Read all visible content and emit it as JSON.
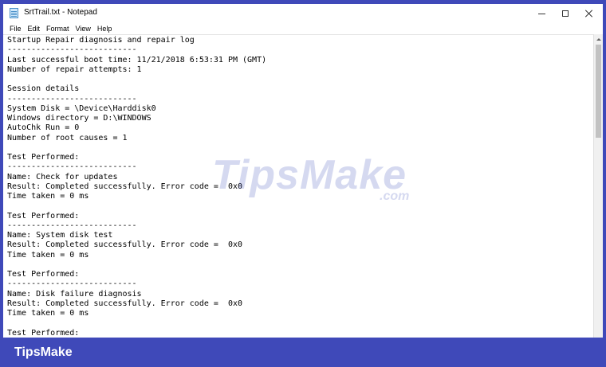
{
  "window": {
    "title": "SrtTrail.txt - Notepad"
  },
  "menu": {
    "items": [
      "File",
      "Edit",
      "Format",
      "View",
      "Help"
    ]
  },
  "document": {
    "lines": [
      "Startup Repair diagnosis and repair log",
      "---------------------------",
      "Last successful boot time: 11/21/2018 6:53:31 PM (GMT)",
      "Number of repair attempts: 1",
      "",
      "Session details",
      "---------------------------",
      "System Disk = \\Device\\Harddisk0",
      "Windows directory = D:\\WINDOWS",
      "AutoChk Run = 0",
      "Number of root causes = 1",
      "",
      "Test Performed:",
      "---------------------------",
      "Name: Check for updates",
      "Result: Completed successfully. Error code =  0x0",
      "Time taken = 0 ms",
      "",
      "Test Performed:",
      "---------------------------",
      "Name: System disk test",
      "Result: Completed successfully. Error code =  0x0",
      "Time taken = 0 ms",
      "",
      "Test Performed:",
      "---------------------------",
      "Name: Disk failure diagnosis",
      "Result: Completed successfully. Error code =  0x0",
      "Time taken = 0 ms",
      "",
      "Test Performed:"
    ]
  },
  "watermark": {
    "text": "TipsMake",
    "suffix": ".com"
  },
  "footer": {
    "logo_text": "TipsMake"
  },
  "colors": {
    "frame": "#3f49b9",
    "background": "#ffffff"
  }
}
